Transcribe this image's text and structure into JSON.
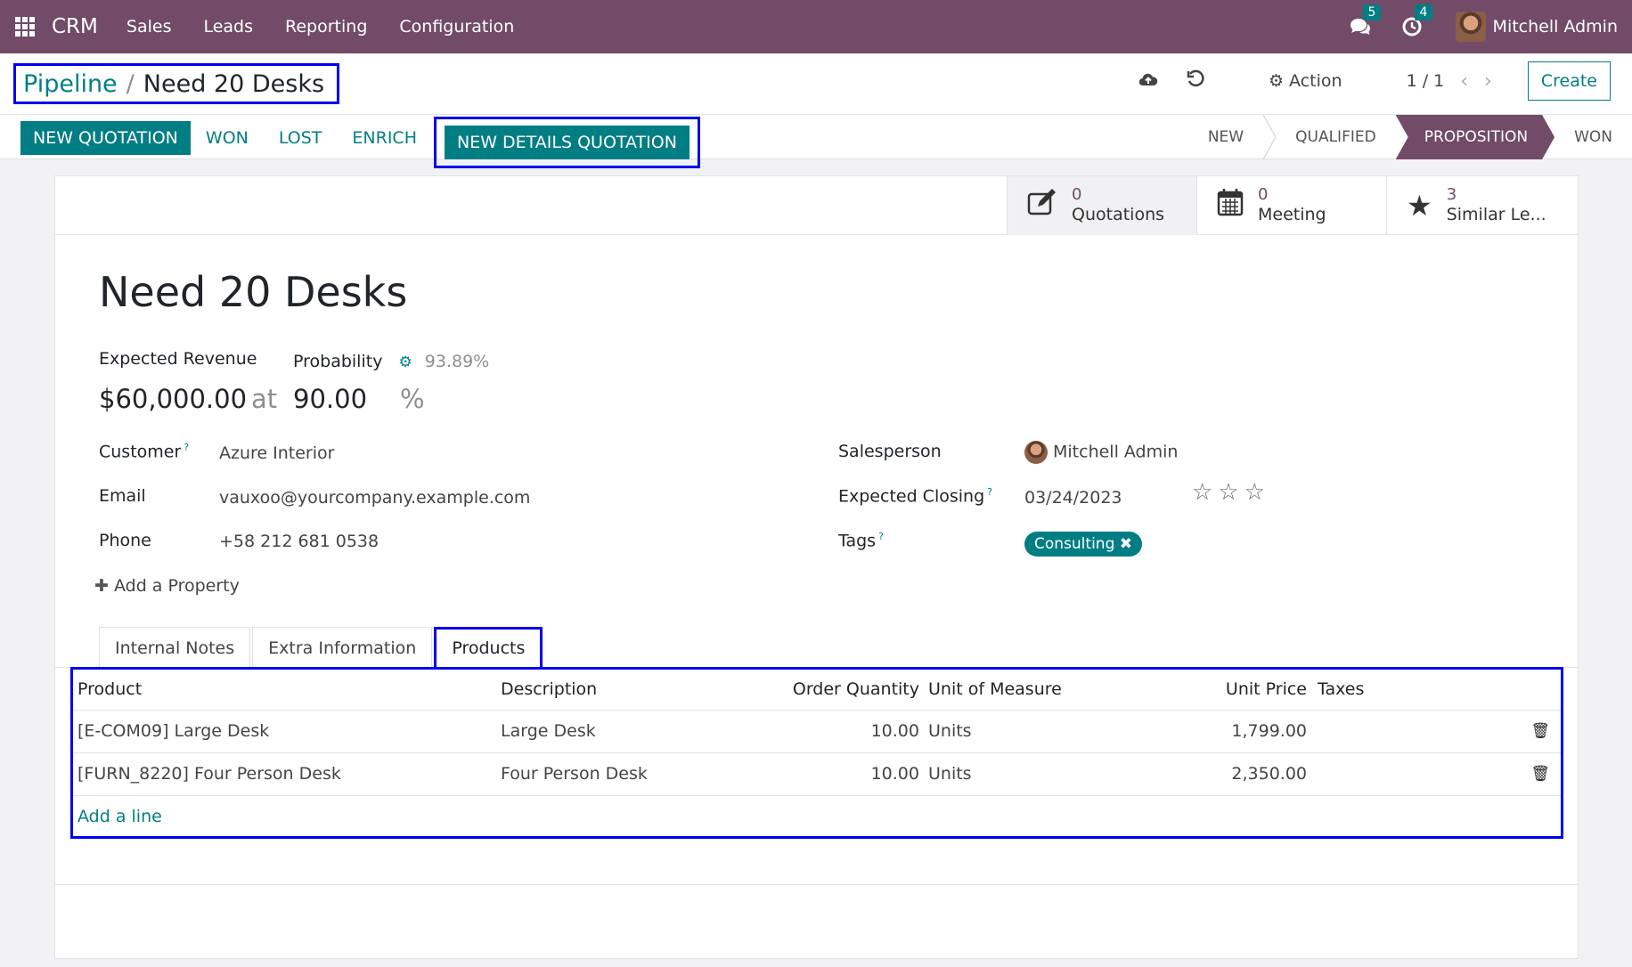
{
  "topnav": {
    "brand": "CRM",
    "menu": [
      "Sales",
      "Leads",
      "Reporting",
      "Configuration"
    ],
    "messages_count": "5",
    "activities_count": "4",
    "user": "Mitchell Admin"
  },
  "breadcrumb": {
    "parent": "Pipeline",
    "separator": "/",
    "current": "Need 20 Desks"
  },
  "control": {
    "action_label": "Action",
    "pager": "1 / 1",
    "create_label": "Create"
  },
  "statusbar": {
    "buttons": {
      "new_quotation": "NEW QUOTATION",
      "won": "WON",
      "lost": "LOST",
      "enrich": "ENRICH",
      "new_details_quotation": "NEW DETAILS QUOTATION"
    },
    "stages": [
      "NEW",
      "QUALIFIED",
      "PROPOSITION",
      "WON"
    ],
    "active_stage": "PROPOSITION"
  },
  "smart_buttons": [
    {
      "count": "0",
      "label": "Quotations",
      "icon": "pencil-square-icon"
    },
    {
      "count": "0",
      "label": "Meeting",
      "icon": "calendar-icon"
    },
    {
      "count": "3",
      "label": "Similar Le...",
      "icon": "star-icon"
    }
  ],
  "form": {
    "title": "Need 20 Desks",
    "expected_revenue_label": "Expected Revenue",
    "expected_revenue": "$60,000.00",
    "at_label": "at",
    "probability_label": "Probability",
    "auto_probability": "93.89%",
    "probability": "90.00",
    "percent": "%",
    "customer_label": "Customer",
    "customer": "Azure Interior",
    "email_label": "Email",
    "email": "vauxoo@yourcompany.example.com",
    "phone_label": "Phone",
    "phone": "+58 212 681 0538",
    "add_property": "Add a Property",
    "salesperson_label": "Salesperson",
    "salesperson": "Mitchell Admin",
    "expected_closing_label": "Expected Closing",
    "expected_closing": "03/24/2023",
    "priority_stars": 0,
    "tags_label": "Tags",
    "tag": "Consulting",
    "help_mark": "?"
  },
  "tabs": [
    "Internal Notes",
    "Extra Information",
    "Products"
  ],
  "products": {
    "headers": {
      "product": "Product",
      "description": "Description",
      "qty": "Order Quantity",
      "uom": "Unit of Measure",
      "price": "Unit Price",
      "taxes": "Taxes"
    },
    "rows": [
      {
        "product": "[E-COM09] Large Desk",
        "description": "Large Desk",
        "qty": "10.00",
        "uom": "Units",
        "price": "1,799.00"
      },
      {
        "product": "[FURN_8220] Four Person Desk",
        "description": "Four Person Desk",
        "qty": "10.00",
        "uom": "Units",
        "price": "2,350.00"
      }
    ],
    "add_line": "Add a line"
  }
}
